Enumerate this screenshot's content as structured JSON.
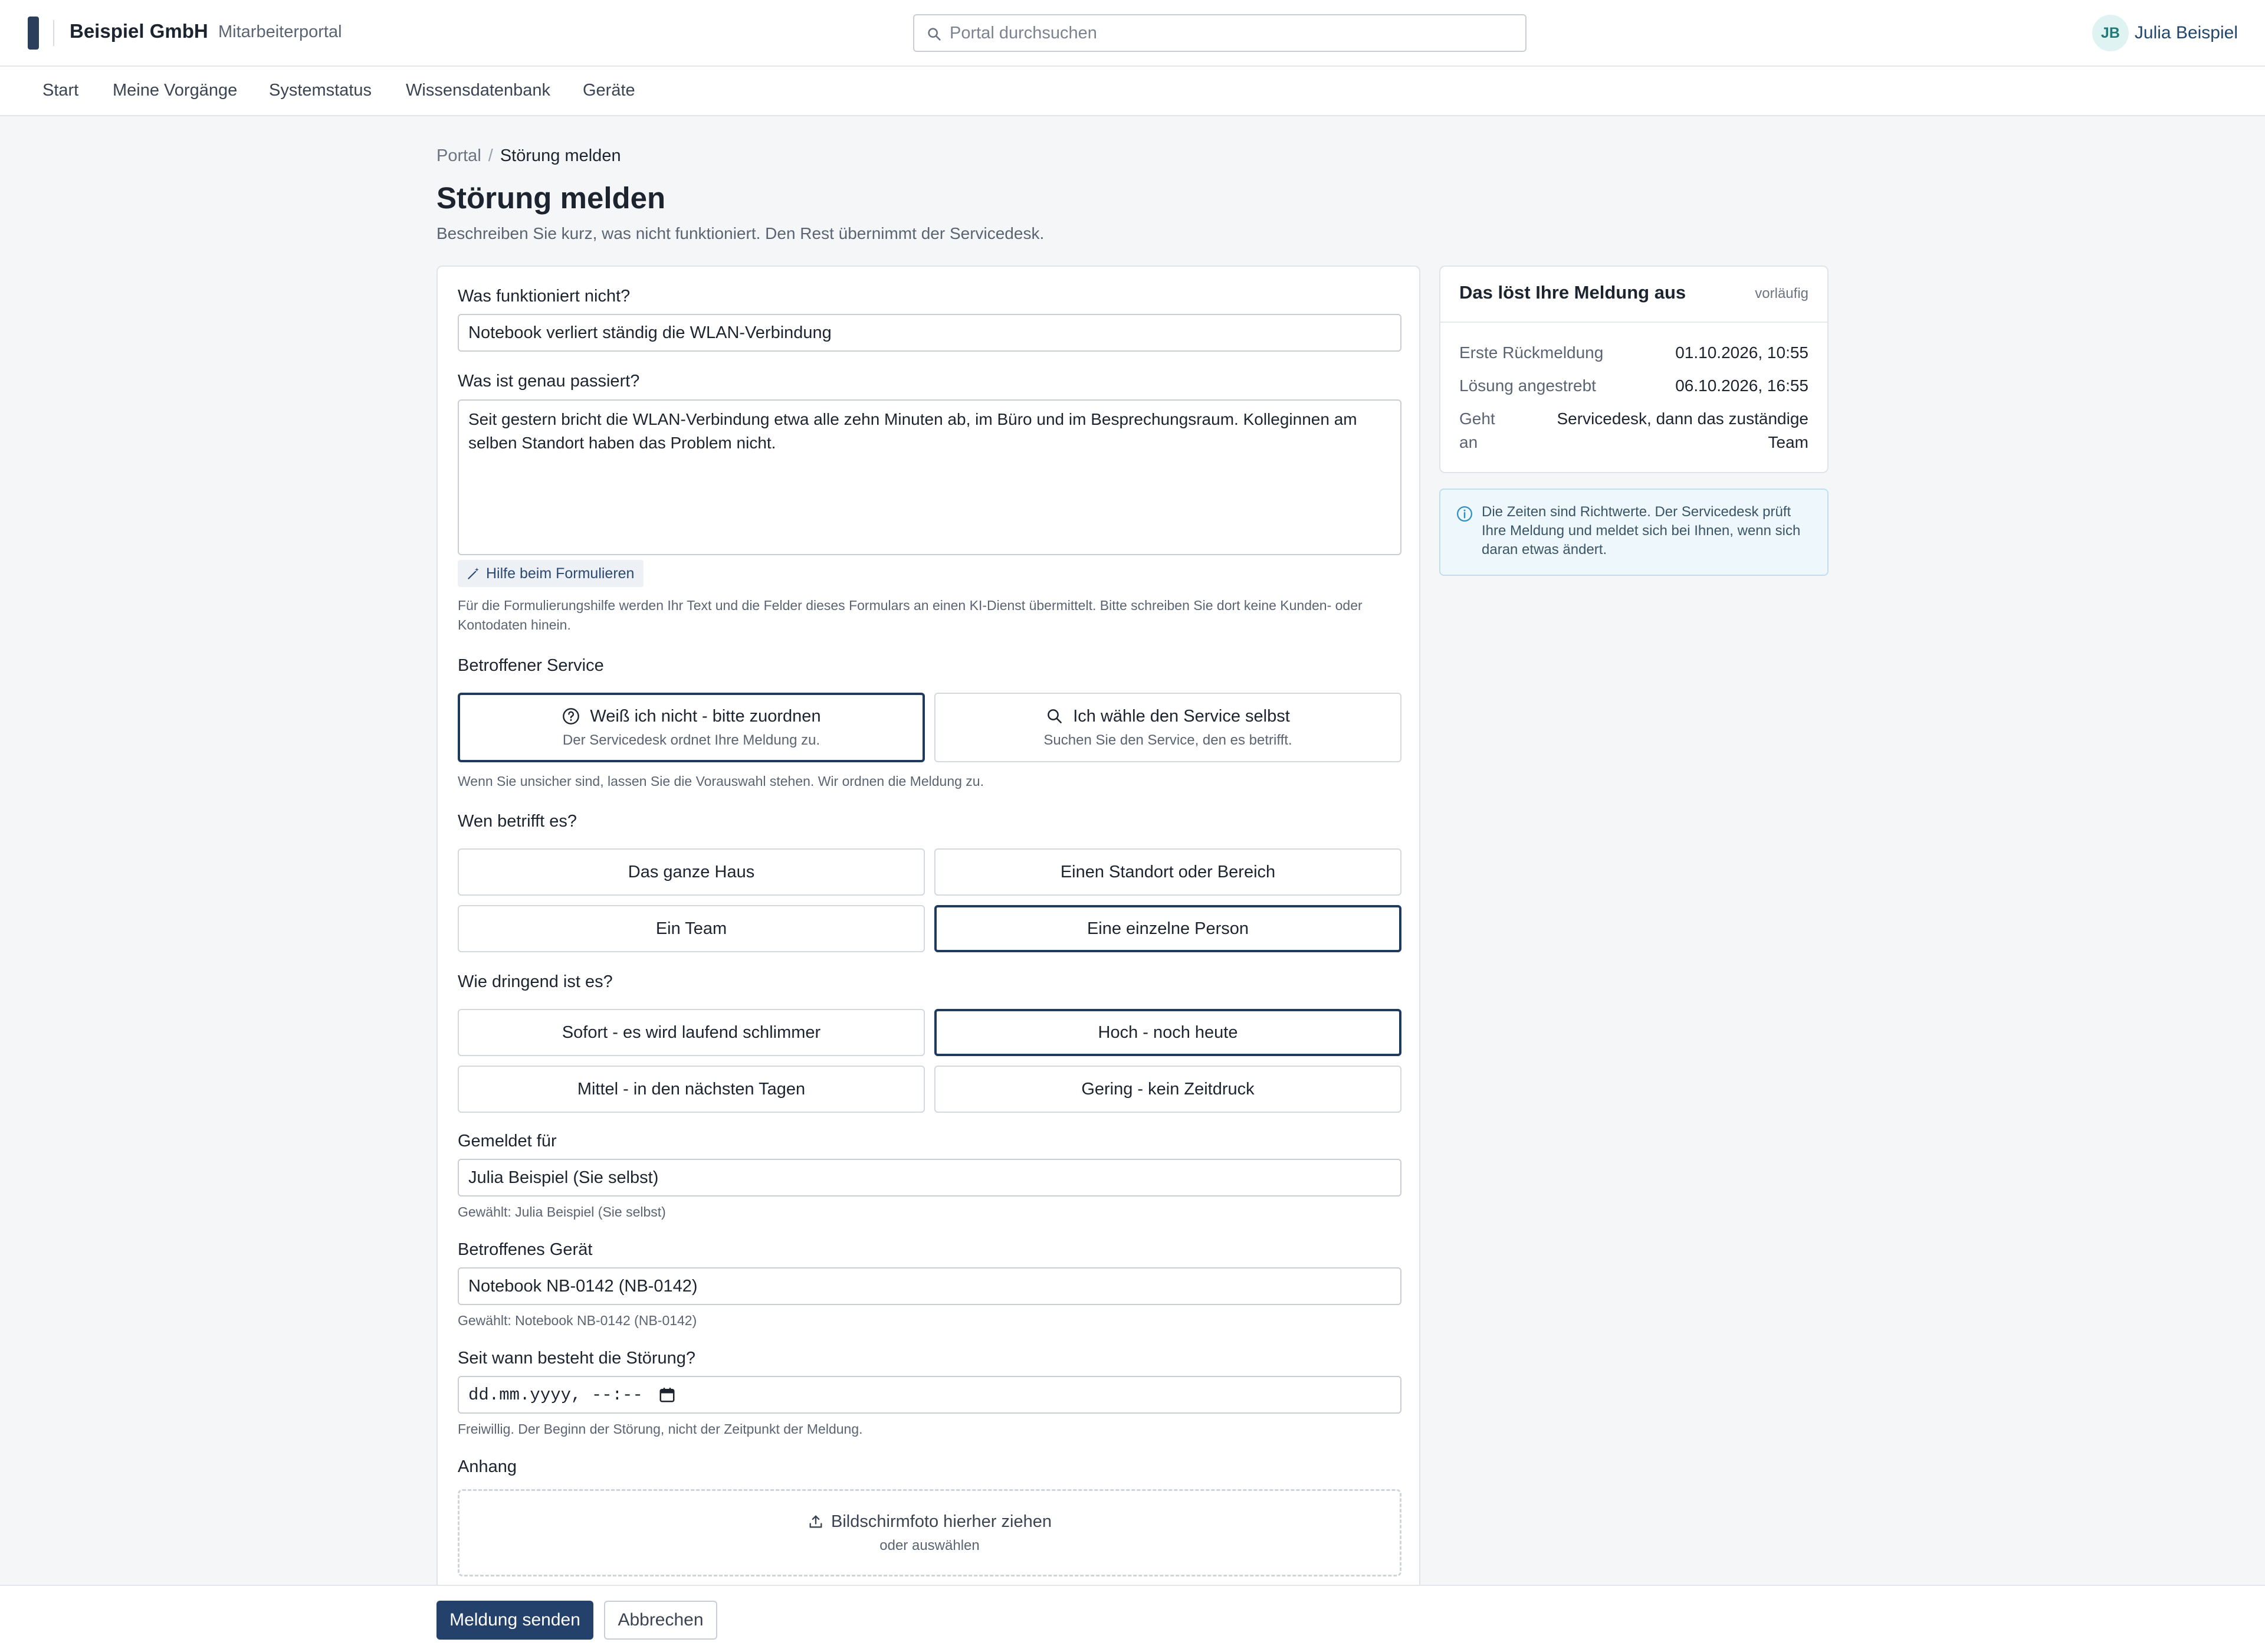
{
  "header": {
    "brand": "Beispiel GmbH",
    "portal": "Mitarbeiterportal",
    "search_placeholder": "Portal durchsuchen",
    "user_initials": "JB",
    "user_name": "Julia Beispiel"
  },
  "nav": {
    "items": [
      "Start",
      "Meine Vorgänge",
      "Systemstatus",
      "Wissensdatenbank",
      "Geräte"
    ]
  },
  "breadcrumb": {
    "root": "Portal",
    "sep": "/",
    "current": "Störung melden"
  },
  "page": {
    "title": "Störung melden",
    "subtitle": "Beschreiben Sie kurz, was nicht funktioniert. Den Rest übernimmt der Servicedesk."
  },
  "form": {
    "q1_label": "Was funktioniert nicht?",
    "q1_value": "Notebook verliert ständig die WLAN-Verbindung",
    "q2_label": "Was ist genau passiert?",
    "q2_value": "Seit gestern bricht die WLAN-Verbindung etwa alle zehn Minuten ab, im Büro und im Besprechungsraum. Kolleginnen am selben Standort haben das Problem nicht.",
    "helper_label": "Hilfe beim Formulieren",
    "helper_hint": "Für die Formulierungshilfe werden Ihr Text und die Felder dieses Formulars an einen KI-Dienst übermittelt. Bitte schreiben Sie dort keine Kunden- oder Kontodaten hinein.",
    "service_label": "Betroffener Service",
    "service_opt1_title": "Weiß ich nicht - bitte zuordnen",
    "service_opt1_sub": "Der Servicedesk ordnet Ihre Meldung zu.",
    "service_opt2_title": "Ich wähle den Service selbst",
    "service_opt2_sub": "Suchen Sie den Service, den es betrifft.",
    "service_hint": "Wenn Sie unsicher sind, lassen Sie die Vorauswahl stehen. Wir ordnen die Meldung zu.",
    "scope_label": "Wen betrifft es?",
    "scope_opts": [
      "Das ganze Haus",
      "Einen Standort oder Bereich",
      "Ein Team",
      "Eine einzelne Person"
    ],
    "urgency_label": "Wie dringend ist es?",
    "urgency_opts": [
      "Sofort - es wird laufend schlimmer",
      "Hoch - noch heute",
      "Mittel - in den nächsten Tagen",
      "Gering - kein Zeitdruck"
    ],
    "reported_for_label": "Gemeldet für",
    "reported_for_value": "Julia Beispiel (Sie selbst)",
    "reported_for_hint": "Gewählt: Julia Beispiel (Sie selbst)",
    "device_label": "Betroffenes Gerät",
    "device_value": "Notebook NB-0142 (NB-0142)",
    "device_hint": "Gewählt: Notebook NB-0142 (NB-0142)",
    "since_label": "Seit wann besteht die Störung?",
    "since_placeholder": "dd.mm.yyyy, --:--",
    "since_hint": "Freiwillig. Der Beginn der Störung, nicht der Zeitpunkt der Meldung.",
    "attach_label": "Anhang",
    "attach_title": "Bildschirmfoto hierher ziehen",
    "attach_sub": "oder auswählen"
  },
  "sidebar": {
    "title": "Das löst Ihre Meldung aus",
    "badge": "vorläufig",
    "rows": [
      {
        "k": "Erste Rückmeldung",
        "v": "01.10.2026, 10:55"
      },
      {
        "k": "Lösung angestrebt",
        "v": "06.10.2026, 16:55"
      },
      {
        "k": "Geht an",
        "v": "Servicedesk, dann das zuständige Team"
      }
    ],
    "info": "Die Zeiten sind Richtwerte. Der Servicedesk prüft Ihre Meldung und meldet sich bei Ihnen, wenn sich daran etwas ändert."
  },
  "footer": {
    "submit": "Meldung senden",
    "cancel": "Abbrechen"
  },
  "colors": {
    "primary": "#23416a",
    "selected_border": "#1f3a5c",
    "info_bg": "#eef7fc",
    "avatar_bg": "#dff3f2"
  }
}
